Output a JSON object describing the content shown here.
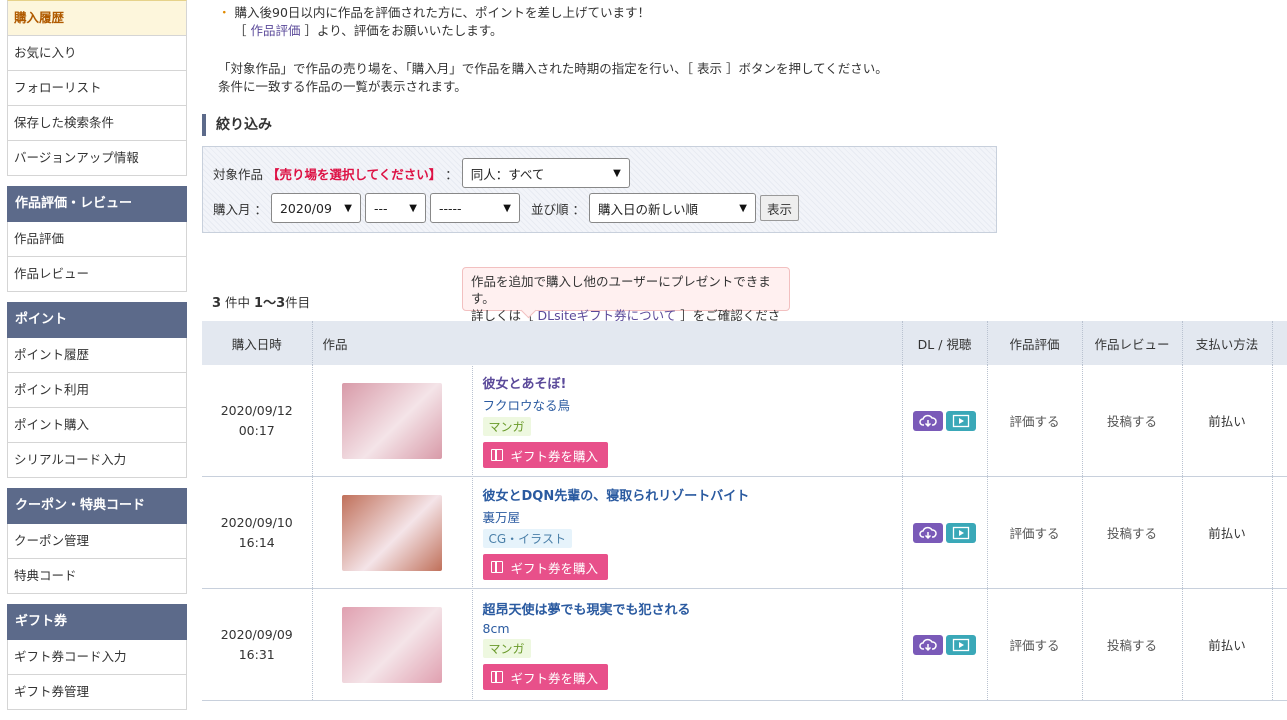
{
  "sidebar": {
    "groups": [
      {
        "items": [
          "購入履歴",
          "お気に入り",
          "フォローリスト",
          "保存した検索条件",
          "バージョンアップ情報"
        ]
      },
      {
        "title": "作品評価・レビュー",
        "items": [
          "作品評価",
          "作品レビュー"
        ]
      },
      {
        "title": "ポイント",
        "items": [
          "ポイント履歴",
          "ポイント利用",
          "ポイント購入",
          "シリアルコード入力"
        ]
      },
      {
        "title": "クーポン・特典コード",
        "items": [
          "クーポン管理",
          "特典コード"
        ]
      },
      {
        "title": "ギフト券",
        "items": [
          "ギフト券コード入力",
          "ギフト券管理"
        ]
      }
    ]
  },
  "notice": {
    "line1": "購入後90日以内に作品を評価された方に、ポイントを差し上げています！",
    "line2_pre": "［",
    "line2_link": "作品評価",
    "line2_post": "］より、評価をお願いいたします。"
  },
  "desc": {
    "line1": "「対象作品」で作品の売り場を、「購入月」で作品を購入された時期の指定を行い、［ 表示 ］ボタンを押してください。",
    "line2": "条件に一致する作品の一覧が表示されます。"
  },
  "filter": {
    "section_title": "絞り込み",
    "target_label": "対象作品",
    "target_required": "【売り場を選択してください】",
    "colon": "：",
    "target_value": "同人：すべて",
    "month_label": "購入月 ：",
    "year_month": "2020/09",
    "day": "---",
    "extra": "-----",
    "sort_label": "並び順 ：",
    "sort_value": "購入日の新しい順",
    "show_button": "表示"
  },
  "count": {
    "total": "3",
    "unit1": "件中",
    "range": "1〜3",
    "unit2": "件目"
  },
  "tooltip": {
    "line1": "作品を追加で購入し他のユーザーにプレゼントできます。",
    "line2_pre": "詳しくは［",
    "line2_link": "DLsiteギフト券について",
    "line2_post": "］をご確認ください。"
  },
  "table": {
    "headers": [
      "購入日時",
      "作品",
      "DL / 視聴",
      "作品評価",
      "作品レビュー",
      "支払い方法"
    ],
    "rows": [
      {
        "date": "2020/09/12",
        "time": "00:17",
        "title": "彼女とあそぼ!",
        "maker": "フクロウなる鳥",
        "genre": "マンガ",
        "genre_type": "manga",
        "gift": "ギフト券を購入",
        "rate": "評価する",
        "review": "投稿する",
        "payment": "前払い",
        "title_color": "#5b4a9a",
        "thumb_color": "#d89aa8"
      },
      {
        "date": "2020/09/10",
        "time": "16:14",
        "title": "彼女とDQN先輩の、寝取られリゾートバイト",
        "maker": "裏万屋",
        "genre": "CG・イラスト",
        "genre_type": "cg",
        "gift": "ギフト券を購入",
        "rate": "評価する",
        "review": "投稿する",
        "payment": "前払い",
        "title_color": "#2a5aa0",
        "thumb_color": "#c0705a"
      },
      {
        "date": "2020/09/09",
        "time": "16:31",
        "title": "超昂天使は夢でも現実でも犯される",
        "maker": "8cm",
        "genre": "マンガ",
        "genre_type": "manga",
        "gift": "ギフト券を購入",
        "rate": "評価する",
        "review": "投稿する",
        "payment": "前払い",
        "title_color": "#2a5aa0",
        "thumb_color": "#e0a0b0"
      }
    ]
  }
}
